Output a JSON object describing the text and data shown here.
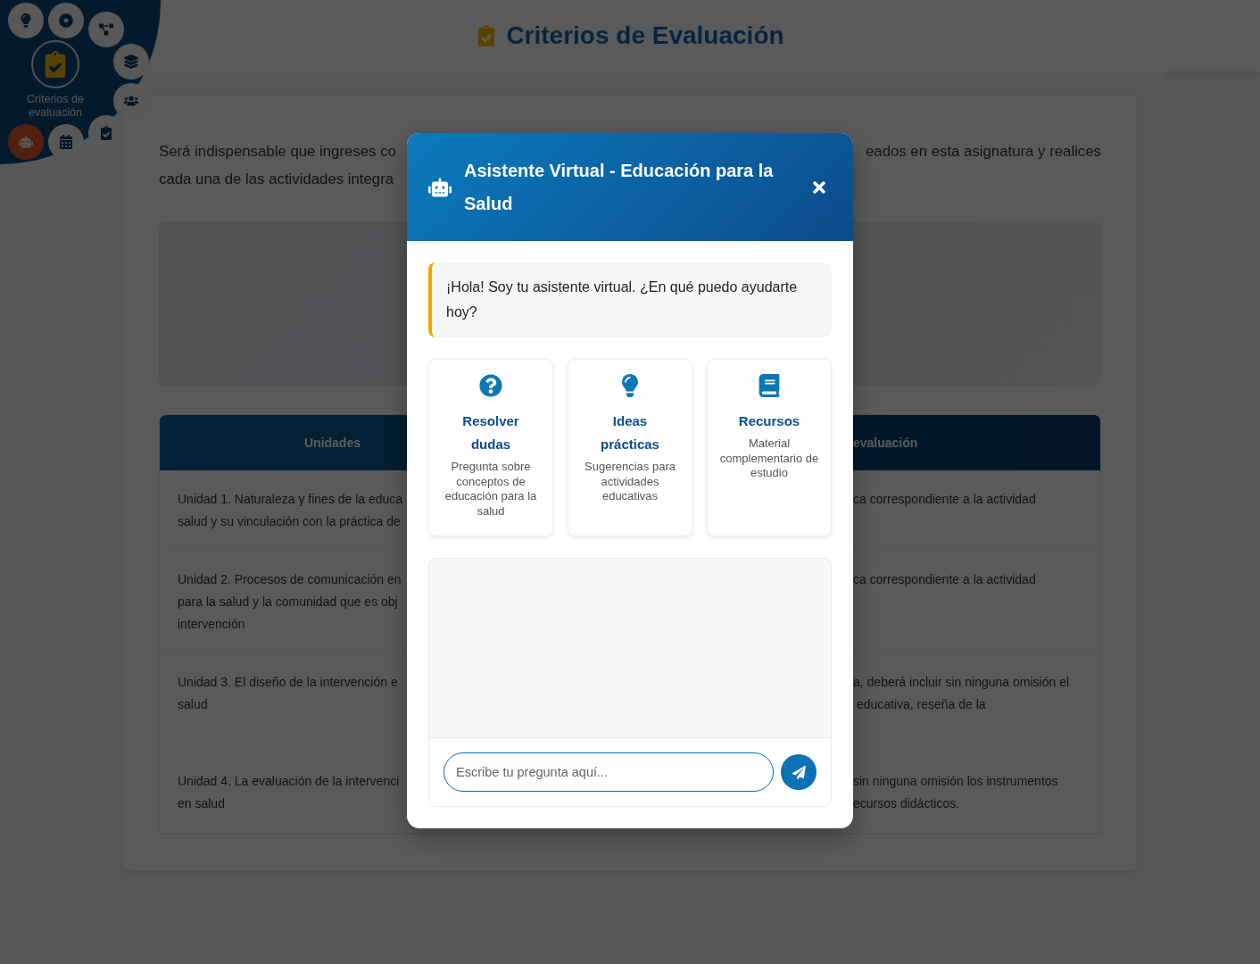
{
  "header": {
    "title": "Criterios de Evaluación"
  },
  "radial_menu": {
    "active_label": "Criterios de evaluación",
    "items": [
      {
        "kind": "lightbulb"
      },
      {
        "kind": "target"
      },
      {
        "kind": "diagram"
      },
      {
        "kind": "layers"
      },
      {
        "kind": "users"
      },
      {
        "kind": "clipboard"
      },
      {
        "kind": "calendar"
      },
      {
        "kind": "assistant"
      }
    ]
  },
  "intro": {
    "left": "Será indispensable que ingreses co\ncada una de las actividades integra",
    "right": "eados en esta asignatura y realices"
  },
  "table": {
    "columns": [
      "Unidades",
      "evaluación"
    ],
    "rows": [
      {
        "cells": [
          "Unidad 1. Naturaleza y fines de la educa\nsalud y su vinculación con la práctica de",
          "ca correspondiente a la actividad"
        ]
      },
      {
        "cells": [
          "Unidad 2. Procesos de comunicación en\npara la salud y la comunidad que es obj\nintervención",
          "ca correspondiente a la actividad"
        ]
      },
      {
        "cells": [
          "Unidad 3. El diseño de la intervención e\nsalud",
          "a, deberá incluir sin ninguna omisión el\n educativa, reseña de la"
        ]
      },
      {
        "cells": [
          "Unidad 4. La evaluación de la intervenci\nen salud",
          "sin ninguna omisión los instrumentos\necursos didácticos."
        ]
      }
    ]
  },
  "dialog": {
    "title": "Asistente Virtual - Educación para la Salud",
    "message": "¡Hola! Soy tu asistente virtual. ¿En qué puedo ayudarte hoy?",
    "options": [
      {
        "kind": "question",
        "title": "Resolver\ndudas",
        "description": "Pregunta sobre conceptos de educación para la salud"
      },
      {
        "kind": "idea",
        "title": "Ideas\nprácticas",
        "description": "Sugerencias para actividades educativas"
      },
      {
        "kind": "book",
        "title": "Recursos",
        "description": "Material complementario de estudio"
      }
    ],
    "input": {
      "placeholder": "Escribe tu pregunta aquí..."
    }
  }
}
